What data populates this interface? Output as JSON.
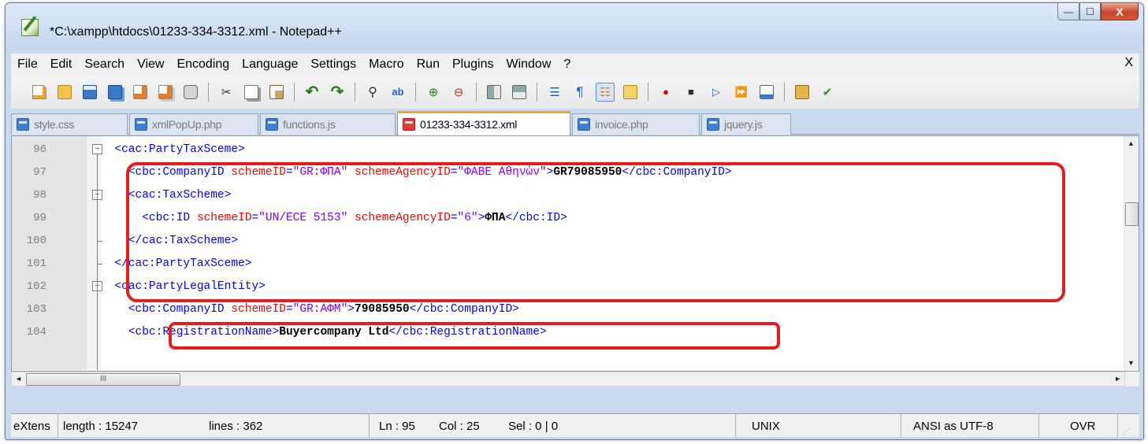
{
  "window": {
    "title": "*C:\\xampp\\htdocs\\01233-334-3312.xml - Notepad++",
    "buttons": {
      "minimize": "—",
      "maximize": "☐",
      "close": "X"
    }
  },
  "menu": {
    "items": [
      "File",
      "Edit",
      "Search",
      "View",
      "Encoding",
      "Language",
      "Settings",
      "Macro",
      "Run",
      "Plugins",
      "Window",
      "?"
    ],
    "close_label": "X"
  },
  "tabs": [
    {
      "label": "style.css",
      "active": false
    },
    {
      "label": "xmlPopUp.php",
      "active": false
    },
    {
      "label": "functions.js",
      "active": false
    },
    {
      "label": "01233-334-3312.xml",
      "active": true
    },
    {
      "label": "invoice.php",
      "active": false
    },
    {
      "label": "jquery.js",
      "active": false
    }
  ],
  "editor": {
    "lines": [
      {
        "num": "96",
        "indent": "  ",
        "parts": [
          [
            "tag",
            "<cac:PartyTaxSceme>"
          ]
        ]
      },
      {
        "num": "97",
        "indent": "    ",
        "parts": [
          [
            "tag",
            "<cbc:CompanyID "
          ],
          [
            "attr",
            "schemeID"
          ],
          [
            "tag",
            "="
          ],
          [
            "val",
            "\"GR:ΦΠΑ\""
          ],
          [
            "tag",
            " "
          ],
          [
            "attr",
            "schemeAgencyID"
          ],
          [
            "tag",
            "="
          ],
          [
            "val",
            "\"ΦΑΒΕ Αθηνών\""
          ],
          [
            "tag",
            ">"
          ],
          [
            "txt",
            "GR79085950"
          ],
          [
            "tag",
            "</cbc:CompanyID>"
          ]
        ]
      },
      {
        "num": "98",
        "indent": "    ",
        "parts": [
          [
            "tag",
            "<cac:TaxScheme>"
          ]
        ]
      },
      {
        "num": "99",
        "indent": "      ",
        "parts": [
          [
            "tag",
            "<cbc:ID "
          ],
          [
            "attr",
            "schemeID"
          ],
          [
            "tag",
            "="
          ],
          [
            "val",
            "\"UN/ECE 5153\""
          ],
          [
            "tag",
            " "
          ],
          [
            "attr",
            "schemeAgencyID"
          ],
          [
            "tag",
            "="
          ],
          [
            "val",
            "\"6\""
          ],
          [
            "tag",
            ">"
          ],
          [
            "txt",
            "ΦΠΑ"
          ],
          [
            "tag",
            "</cbc:ID>"
          ]
        ]
      },
      {
        "num": "100",
        "indent": "    ",
        "parts": [
          [
            "tag",
            "</cac:TaxScheme>"
          ]
        ]
      },
      {
        "num": "101",
        "indent": "  ",
        "parts": [
          [
            "tag",
            "</cac:PartyTaxSceme>"
          ]
        ]
      },
      {
        "num": "102",
        "indent": "  ",
        "parts": [
          [
            "tag",
            "<cac:PartyLegalEntity>"
          ]
        ]
      },
      {
        "num": "103",
        "indent": "    ",
        "parts": [
          [
            "tag",
            "<cbc:CompanyID "
          ],
          [
            "attr",
            "schemeID"
          ],
          [
            "tag",
            "="
          ],
          [
            "val",
            "\"GR:ΑΦΜ\""
          ],
          [
            "tag",
            ">"
          ],
          [
            "txt",
            "79085950"
          ],
          [
            "tag",
            "</cbc:CompanyID>"
          ]
        ]
      },
      {
        "num": "104",
        "indent": "    ",
        "parts": [
          [
            "tag",
            "<cbc:RegistrationName>"
          ],
          [
            "txt",
            "Buyercompany Ltd"
          ],
          [
            "tag",
            "</cbc:RegistrationName>"
          ]
        ]
      },
      {
        "num": "",
        "indent": "",
        "parts": []
      }
    ],
    "hscroll_thumb_label": "III"
  },
  "status": {
    "file_type": "eXtens",
    "length": "length : 15247",
    "lines": "lines : 362",
    "ln": "Ln : 95",
    "col": "Col : 25",
    "sel": "Sel : 0 | 0",
    "eol": "UNIX",
    "encoding": "ANSI as UTF-8",
    "mode": "OVR"
  },
  "colors": {
    "tag": "#0000ff",
    "attr": "#ff0000",
    "value": "#8000ff",
    "highlight": "#e02020",
    "active_tab_accent": "#f6a623"
  }
}
